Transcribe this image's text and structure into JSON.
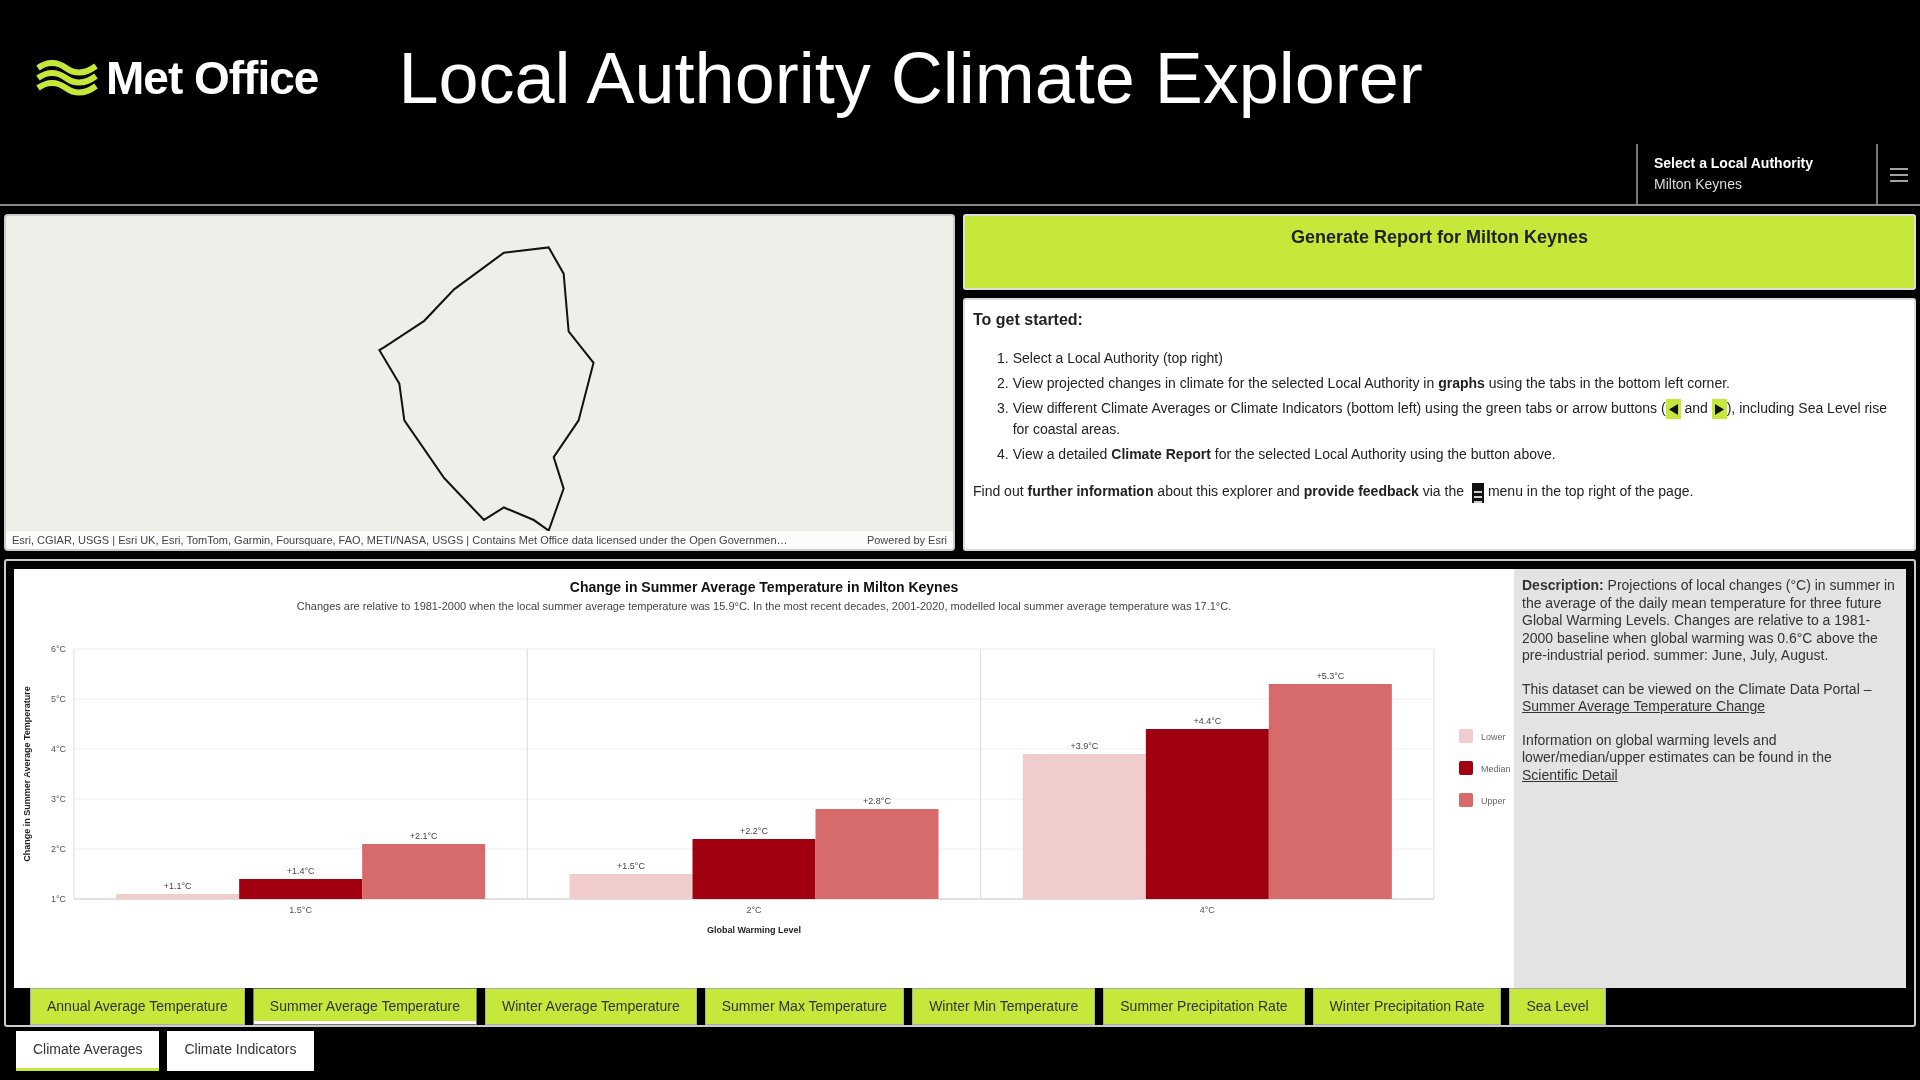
{
  "header": {
    "logo_text": "Met Office",
    "title": "Local Authority Climate Explorer",
    "selector": {
      "label": "Select a Local Authority",
      "value": "Milton Keynes"
    }
  },
  "map": {
    "attribution": "Esri, CGIAR, USGS | Esri UK, Esri, TomTom, Garmin, Foursquare, FAO, METI/NASA, USGS | Contains Met Office data licensed under the Open Governmen…",
    "powered_by": "Powered by Esri"
  },
  "report_button": "Generate Report for Milton Keynes",
  "instructions": {
    "heading": "To get started:",
    "steps": [
      {
        "number": "1.",
        "text": "Select a Local Authority (top right)"
      },
      {
        "number": "2.",
        "text": "View projected changes in climate for the selected Local Authority in **graphs** using the tabs in the bottom left corner."
      },
      {
        "number": "3.",
        "text": "View different Climate Averages or Climate Indicators (bottom left) using the green tabs or arrow buttons (",
        "continuation": [
          " and ",
          "), including Sea Level rise for coastal areas."
        ]
      },
      {
        "number": "4.",
        "text": "View a detailed **Climate Report** for the selected Local Authority using the button above."
      }
    ],
    "footer": {
      "text": "Find out **further information** about this explorer and **provide feedback** via the",
      "after": "menu in the top right of the page."
    }
  },
  "chart": {
    "title": "Change in Summer Average Temperature in Milton Keynes",
    "subtitle": "Changes are relative to 1981-2000 when the local summer average temperature was 15.9°C. In the most recent decades, 2001-2020, modelled local summer average temperature was 17.1°C.",
    "chart_data": {
      "type": "bar",
      "xlabel": "Global Warming Level",
      "ylabel": "Change in Summer Average Temperature",
      "categories": [
        "1.5°C",
        "2°C",
        "4°C"
      ],
      "series": [
        {
          "name": "Lower",
          "color": "#f0cccc",
          "values": [
            1.1,
            1.5,
            3.9
          ]
        },
        {
          "name": "Median",
          "color": "#a00010",
          "values": [
            1.4,
            2.2,
            4.4
          ]
        },
        {
          "name": "Upper",
          "color": "#d76a6a",
          "values": [
            2.1,
            2.8,
            5.3
          ]
        }
      ],
      "ylim": [
        1,
        6
      ],
      "grid": true,
      "legend": true,
      "yticks": [
        {
          "value": 1,
          "label": "1°C"
        },
        {
          "value": 2,
          "label": "2°C"
        },
        {
          "value": 3,
          "label": "3°C"
        },
        {
          "value": 4,
          "label": "4°C"
        },
        {
          "value": 5,
          "label": "5°C"
        },
        {
          "value": 6,
          "label": "6°C"
        }
      ],
      "value_labels": [
        [
          "+1.1°C",
          "+1.5°C",
          "+3.9°C"
        ],
        [
          "+1.4°C",
          "+2.2°C",
          "+4.4°C"
        ],
        [
          "+2.1°C",
          "+2.8°C",
          "+5.3°C"
        ]
      ]
    }
  },
  "description": {
    "text": "**Description:** Projections of local changes (°C) in summer in the average of the daily mean temperature for three future Global Warming Levels. Changes are relative to a 1981-2000 baseline when global warming was 0.6°C above the pre-industrial period. summer: June, July, August.",
    "portal_text": "This dataset can be viewed on the Climate Data Portal –",
    "portal_link": "Summer Average Temperature Change",
    "info_text": "Information on global warming levels and lower/median/upper estimates can be found in the",
    "info_link": "Scientific Detail"
  },
  "variable_tabs": [
    {
      "label": "Annual Average Temperature",
      "selected": false
    },
    {
      "label": "Summer Average Temperature",
      "selected": true
    },
    {
      "label": "Winter Average Temperature",
      "selected": false
    },
    {
      "label": "Summer Max Temperature",
      "selected": false
    },
    {
      "label": "Winter Min Temperature",
      "selected": false
    },
    {
      "label": "Summer Precipitation Rate",
      "selected": false
    },
    {
      "label": "Winter Precipitation Rate",
      "selected": false
    },
    {
      "label": "Sea Level",
      "selected": false
    }
  ],
  "category_tabs": [
    {
      "label": "Climate Averages",
      "selected": true
    },
    {
      "label": "Climate Indicators",
      "selected": false
    }
  ]
}
